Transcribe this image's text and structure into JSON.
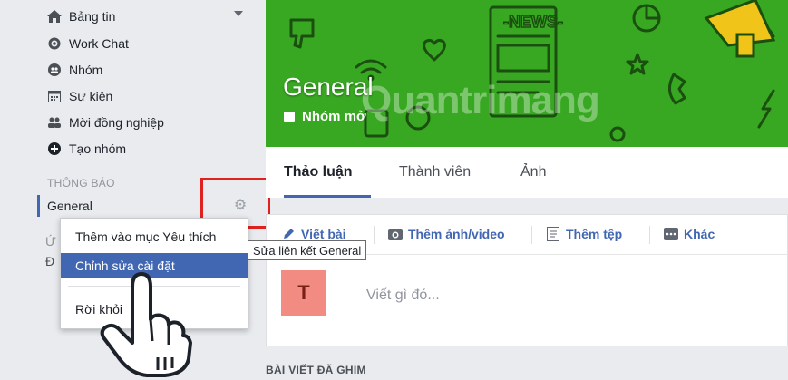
{
  "sidebar": {
    "items": [
      {
        "label": "Bảng tin",
        "icon": "home-icon"
      },
      {
        "label": "Work Chat",
        "icon": "chat-icon"
      },
      {
        "label": "Nhóm",
        "icon": "groups-icon"
      },
      {
        "label": "Sự kiện",
        "icon": "calendar-icon"
      },
      {
        "label": "Mời đồng nghiệp",
        "icon": "invite-icon"
      },
      {
        "label": "Tạo nhóm",
        "icon": "plus-icon"
      }
    ],
    "section_title": "THÔNG BÁO",
    "active_group": "General",
    "sub_label": "Ứ",
    "sub_label2": "Đ"
  },
  "menu": {
    "items": [
      "Thêm vào mục Yêu thích",
      "Chỉnh sửa cài đặt",
      "Rời khỏi"
    ],
    "active_index": 1
  },
  "tooltip": "Sửa liên kết General",
  "cover": {
    "title": "General",
    "subtitle": "Nhóm mở",
    "watermark": "Quantrimang",
    "news_text": "NEWS"
  },
  "tabs": [
    "Thảo luận",
    "Thành viên",
    "Ảnh"
  ],
  "composer": {
    "actions": [
      "Viết bài",
      "Thêm ảnh/video",
      "Thêm tệp",
      "Khác"
    ],
    "avatar_letter": "T",
    "placeholder": "Viết gì đó..."
  },
  "pinned_title": "BÀI VIẾT ĐÃ GHIM",
  "colors": {
    "accent": "#4267b2",
    "cover_green": "#38a822",
    "highlight_red": "#e0221f",
    "avatar": "#f28b82"
  }
}
